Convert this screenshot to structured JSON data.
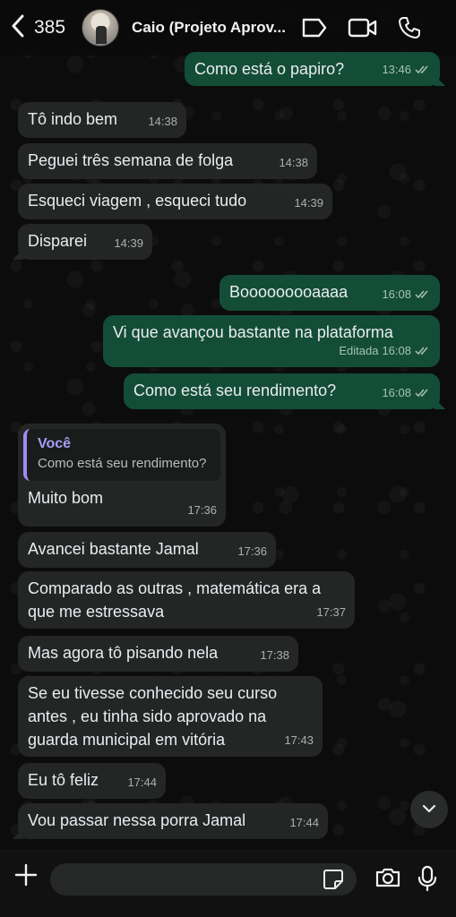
{
  "header": {
    "back_count": "385",
    "contact_name": "Caio (Projeto Aprov..."
  },
  "messages": [
    {
      "dir": "out",
      "text": "Como está o papiro?",
      "time": "13:46",
      "ticks": true
    },
    {
      "dir": "in",
      "text": "Tô indo bem",
      "time": "14:38"
    },
    {
      "dir": "in",
      "text": "Peguei três semana de folga",
      "time": "14:38"
    },
    {
      "dir": "in",
      "text": "Esqueci viagem , esqueci tudo",
      "time": "14:39"
    },
    {
      "dir": "in",
      "text": "Disparei",
      "time": "14:39"
    },
    {
      "dir": "out",
      "text": "Booooooooaaaa",
      "time": "16:08",
      "ticks": true
    },
    {
      "dir": "out",
      "text": "Vi que avançou bastante na plataforma",
      "time": "16:08",
      "edited": "Editada",
      "ticks": true
    },
    {
      "dir": "out",
      "text": "Como está seu rendimento?",
      "time": "16:08",
      "ticks": true
    },
    {
      "dir": "in",
      "text": "Muito bom",
      "time": "17:36",
      "quote": {
        "author": "Você",
        "text": "Como está seu rendimento?"
      }
    },
    {
      "dir": "in",
      "text": "Avancei bastante Jamal",
      "time": "17:36"
    },
    {
      "dir": "in",
      "text": "Comparado as outras , matemática era a que me estressava",
      "time": "17:37"
    },
    {
      "dir": "in",
      "text": "Mas agora tô pisando nela",
      "time": "17:38"
    },
    {
      "dir": "in",
      "text": "Se eu tivesse conhecido seu curso antes , eu tinha sido aprovado na guarda municipal  em vitória",
      "time": "17:43"
    },
    {
      "dir": "in",
      "text": "Eu tô feliz",
      "time": "17:44"
    },
    {
      "dir": "in",
      "text": "Vou passar nessa porra Jamal",
      "time": "17:44"
    }
  ],
  "composer": {
    "placeholder": ""
  },
  "colors": {
    "incoming_bubble": "#242626",
    "outgoing_bubble": "#144d37",
    "quote_accent": "#9e8cf2"
  },
  "icons": [
    "chevron-left-icon",
    "label-tag-icon",
    "video-camera-icon",
    "phone-icon",
    "chevron-down-icon",
    "plus-icon",
    "sticker-icon",
    "camera-icon",
    "microphone-icon",
    "double-check-icon"
  ]
}
